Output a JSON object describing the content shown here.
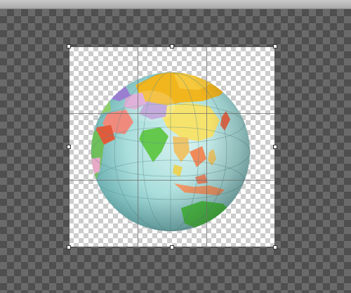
{
  "colors": {
    "workspace_dark": "#4f4f4f",
    "workspace_light": "#6a6a6a",
    "transparency_light": "#ffffff",
    "transparency_dark": "#cccccc",
    "ocean": "#b8e3e3",
    "handle_fill": "#ffffff"
  },
  "canvas": {
    "layer_content": "globe-image",
    "transform_mode": "free-transform"
  }
}
